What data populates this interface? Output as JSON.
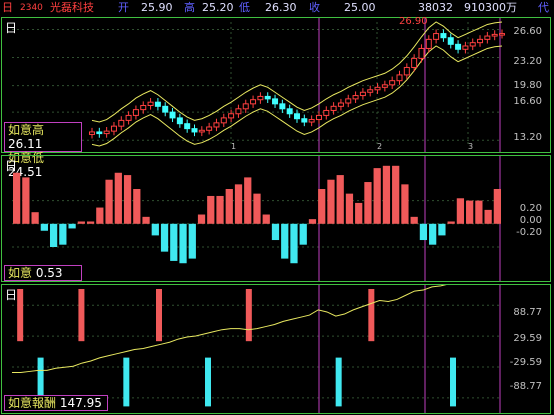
{
  "header": {
    "day_tag": "日",
    "code": "2340",
    "name": "光磊科技",
    "open_marker": "开",
    "open": "25.90",
    "high_marker": "高",
    "high": "25.20",
    "low_marker": "低",
    "low": "26.30",
    "close_marker": "收",
    "close": "25.00",
    "volume": "38032",
    "amount": "910300万",
    "extra": "代"
  },
  "price_panel": {
    "tag": "日",
    "axis_labels": [
      "26.60",
      "23.20",
      "19.80",
      "16.60",
      "13.20"
    ],
    "peak_label": "26.90",
    "month_labels": [
      "1",
      "2",
      "3"
    ],
    "indicator_high_label": "如意高",
    "indicator_high_value": "26.11",
    "indicator_low_label": "如意低",
    "indicator_low_value": "24.51",
    "colors": {
      "up": "#ff4040",
      "down": "#40ffff",
      "band": "#e8e860",
      "grid": "#40c040",
      "cursor": "#c040c0"
    }
  },
  "osc_panel": {
    "tag": "日",
    "axis_labels": [
      "0.20",
      "0.00",
      "-0.20"
    ],
    "indicator_label": "如意",
    "indicator_value": "0.53"
  },
  "ret_panel": {
    "tag": "日",
    "axis_labels": [
      "88.77",
      "29.59",
      "-29.59",
      "-88.77"
    ],
    "indicator_label": "如意報酬",
    "indicator_value": "147.95"
  },
  "chart_data": [
    {
      "type": "candlestick",
      "title": "",
      "close": [
        14.2,
        14.0,
        14.3,
        14.9,
        15.6,
        16.2,
        16.9,
        17.4,
        17.8,
        17.3,
        16.6,
        15.9,
        15.2,
        14.6,
        14.2,
        14.4,
        14.8,
        15.3,
        15.9,
        16.4,
        17.0,
        17.6,
        18.1,
        18.5,
        18.2,
        17.6,
        17.0,
        16.4,
        15.8,
        15.4,
        15.7,
        16.2,
        16.8,
        17.3,
        17.7,
        18.2,
        18.6,
        19.0,
        19.3,
        19.6,
        19.9,
        20.4,
        21.1,
        22.0,
        23.1,
        24.3,
        25.4,
        26.1,
        25.6,
        24.8,
        24.2,
        24.6,
        25.0,
        25.4,
        25.8,
        26.0,
        26.1
      ],
      "ylim": [
        12.5,
        27.5
      ]
    },
    {
      "type": "bar",
      "title": "",
      "values": [
        0.44,
        0.4,
        0.1,
        -0.06,
        -0.2,
        -0.18,
        -0.04,
        0.02,
        0.02,
        0.14,
        0.38,
        0.44,
        0.42,
        0.3,
        0.06,
        -0.1,
        -0.24,
        -0.32,
        -0.34,
        -0.3,
        0.08,
        0.24,
        0.24,
        0.3,
        0.34,
        0.4,
        0.26,
        0.08,
        -0.14,
        -0.3,
        -0.34,
        -0.18,
        0.04,
        0.3,
        0.38,
        0.42,
        0.26,
        0.18,
        0.36,
        0.48,
        0.5,
        0.5,
        0.34,
        0.06,
        -0.14,
        -0.18,
        -0.1,
        0.02,
        0.22,
        0.2,
        0.2,
        0.12,
        0.3
      ],
      "ylim": [
        -0.45,
        0.55
      ]
    },
    {
      "type": "line",
      "title": "",
      "line": [
        -40,
        -40,
        -38,
        -36,
        -36,
        -32,
        -30,
        -28,
        -22,
        -18,
        -12,
        -8,
        -4,
        0,
        4,
        6,
        10,
        14,
        18,
        24,
        28,
        30,
        34,
        38,
        42,
        44,
        44,
        42,
        44,
        48,
        52,
        58,
        62,
        66,
        70,
        80,
        76,
        68,
        72,
        80,
        86,
        92,
        98,
        96,
        100,
        108,
        116,
        118,
        124,
        126,
        130,
        136,
        138,
        134,
        140,
        144,
        146
      ],
      "buy_signals_index": [
        7,
        28,
        48,
        80,
        108
      ],
      "sell_signals_index": [
        2,
        17,
        36,
        58,
        88
      ],
      "ylim": [
        -110,
        120
      ]
    }
  ]
}
